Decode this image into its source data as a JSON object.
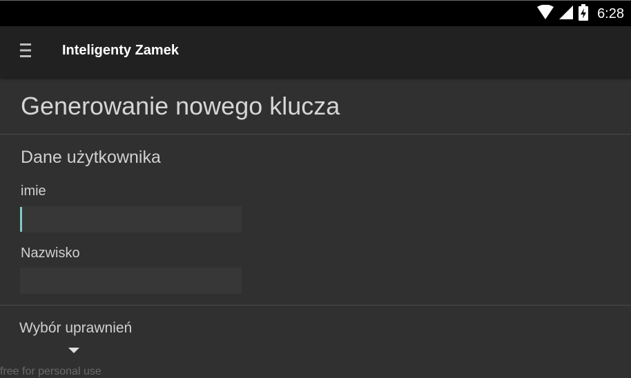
{
  "status_bar": {
    "time": "6:28",
    "icons": [
      "wifi-icon",
      "cell-signal-icon",
      "battery-charging-icon"
    ]
  },
  "app_bar": {
    "title": "Inteligenty Zamek",
    "menu_icon": "hamburger-menu-icon"
  },
  "page": {
    "title": "Generowanie nowego klucza"
  },
  "user_section": {
    "title": "Dane użytkownika",
    "first_name_label": "imie",
    "first_name_value": "",
    "last_name_label": "Nazwisko",
    "last_name_value": ""
  },
  "permissions": {
    "label": "Wybór uprawnień",
    "dropdown_icon": "dropdown-arrow-icon"
  },
  "watermark": "free for personal use",
  "colors": {
    "background": "#303030",
    "app_bar": "#212121",
    "status_bar": "#000000",
    "accent": "#80cbc4"
  }
}
